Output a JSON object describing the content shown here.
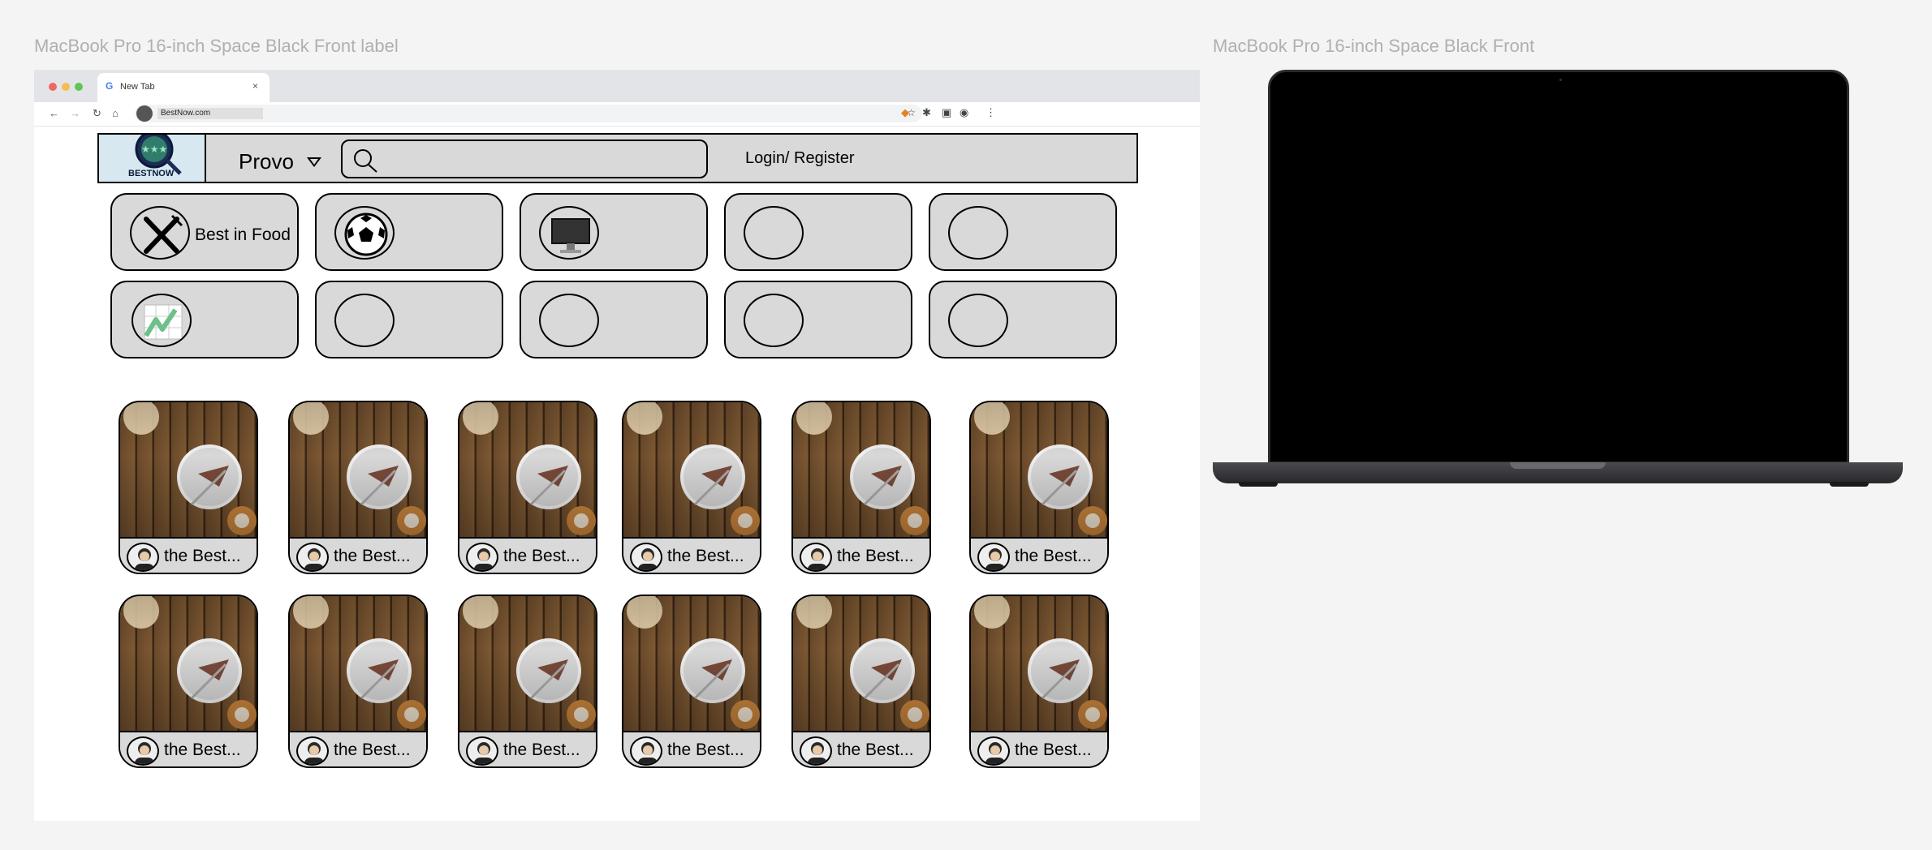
{
  "frames": {
    "left_label": "MacBook Pro 16-inch Space Black Front label",
    "right_label": "MacBook Pro 16-inch Space Black Front"
  },
  "browser": {
    "tab_title": "New Tab",
    "tab_close": "×",
    "url": "BestNow.com"
  },
  "header": {
    "logo_text": "BESTNOW",
    "city": "Provo",
    "search_placeholder": "",
    "login": "Login/ Register"
  },
  "categories": [
    {
      "label": "Best in Food",
      "icon": "fork-knife-icon"
    },
    {
      "label": "",
      "icon": "soccer-ball-icon"
    },
    {
      "label": "",
      "icon": "monitor-icon"
    },
    {
      "label": "",
      "icon": ""
    },
    {
      "label": "",
      "icon": ""
    },
    {
      "label": "",
      "icon": "trending-chart-icon"
    },
    {
      "label": "",
      "icon": ""
    },
    {
      "label": "",
      "icon": ""
    },
    {
      "label": "",
      "icon": ""
    },
    {
      "label": "",
      "icon": ""
    }
  ],
  "cards": [
    {
      "caption": "the Best..."
    },
    {
      "caption": "the Best..."
    },
    {
      "caption": "the Best..."
    },
    {
      "caption": "the Best..."
    },
    {
      "caption": "the Best..."
    },
    {
      "caption": "the Best..."
    },
    {
      "caption": "the Best..."
    },
    {
      "caption": "the Best..."
    },
    {
      "caption": "the Best..."
    },
    {
      "caption": "the Best..."
    },
    {
      "caption": "the Best..."
    },
    {
      "caption": "the Best..."
    }
  ],
  "colors": {
    "panel_gray": "#d9d9d9",
    "outline": "#000000",
    "canvas": "#f4f4f4"
  }
}
